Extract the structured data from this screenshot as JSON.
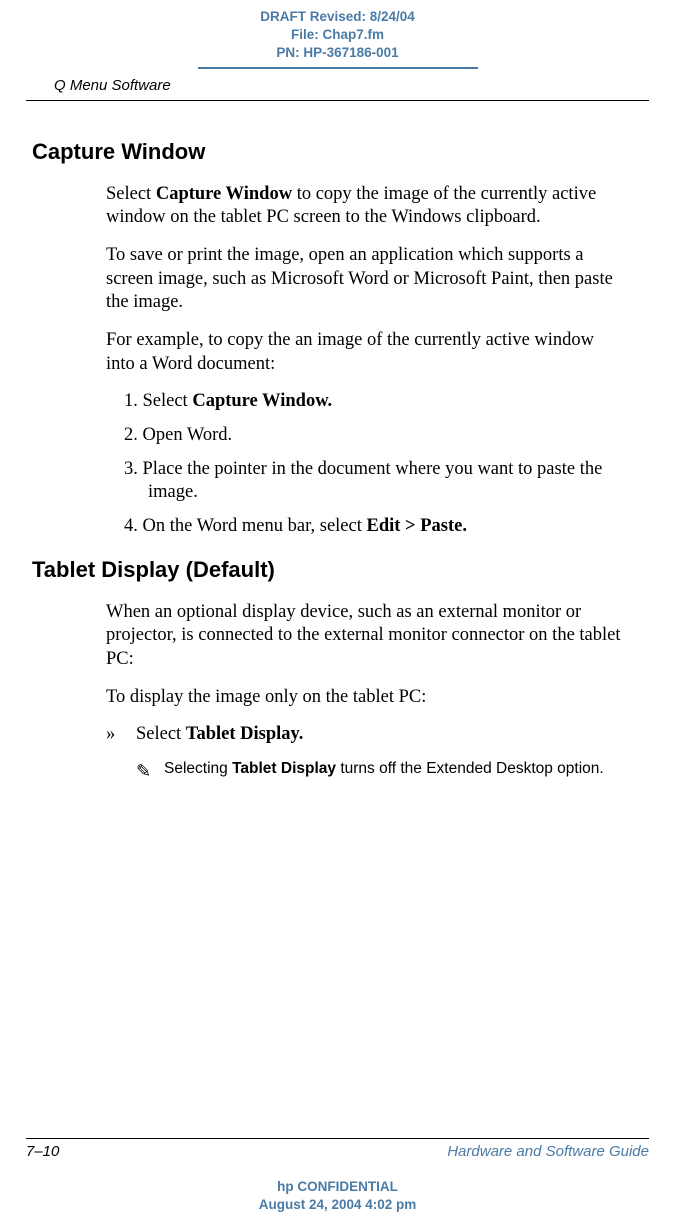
{
  "header": {
    "draft_line": "DRAFT Revised: 8/24/04",
    "file_line": "File: Chap7.fm",
    "pn_line": "PN: HP-367186-001",
    "running_head": "Q Menu Software"
  },
  "section1": {
    "title": "Capture Window",
    "p1_pre": "Select ",
    "p1_bold": "Capture Window",
    "p1_post": " to copy the image of the currently active window on the tablet PC screen to the Windows clipboard.",
    "p2": "To save or print the image, open an application which supports a screen image, such as Microsoft Word or Microsoft Paint, then paste the image.",
    "p3": "For example, to copy the an image of the currently active window into a Word document:",
    "steps": {
      "s1_pre": "1. Select ",
      "s1_bold": "Capture Window.",
      "s2": "2. Open Word.",
      "s3": "3. Place the pointer in the document where you want to paste the image.",
      "s4_pre": "4. On the Word menu bar, select ",
      "s4_bold": "Edit > Paste."
    }
  },
  "section2": {
    "title": "Tablet Display (Default)",
    "p1": "When an optional display device, such as an external monitor or projector, is connected to the external monitor connector on the tablet PC:",
    "p2": "To display the image only on the tablet PC:",
    "arrow_sym": "»",
    "arrow_pre": "Select ",
    "arrow_bold": "Tablet Display.",
    "note_icon": "✎",
    "note_pre": "Selecting ",
    "note_bold": "Tablet Display",
    "note_post": " turns off the Extended Desktop option."
  },
  "footer": {
    "page_num": "7–10",
    "guide_title": "Hardware and Software Guide",
    "conf_line1": "hp CONFIDENTIAL",
    "conf_line2": "August 24, 2004 4:02 pm"
  }
}
